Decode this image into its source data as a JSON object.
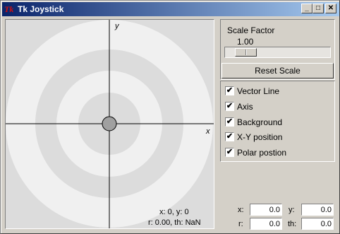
{
  "window": {
    "title": "Tk Joystick",
    "icon_text": "Tk",
    "controls": {
      "minimize": "_",
      "maximize": "□",
      "close": "✕"
    }
  },
  "canvas": {
    "x_axis_label": "x",
    "y_axis_label": "y",
    "readout_xy": "x:    0, y:    0",
    "readout_polar": "r: 0.00, th: NaN"
  },
  "scale": {
    "label": "Scale Factor",
    "value": "1.00",
    "reset_label": "Reset Scale"
  },
  "options": [
    {
      "label": "Vector Line",
      "checked": true
    },
    {
      "label": "Axis",
      "checked": true
    },
    {
      "label": "Background",
      "checked": true
    },
    {
      "label": "X-Y position",
      "checked": true
    },
    {
      "label": "Polar postion",
      "checked": true
    }
  ],
  "fields": {
    "x_label": "x:",
    "x_value": "0.0",
    "y_label": "y:",
    "y_value": "0.0",
    "r_label": "r:",
    "r_value": "0.0",
    "th_label": "th:",
    "th_value": "0.0"
  },
  "colors": {
    "ring_light": "#f0f0f0",
    "ring_dark": "#dcdcdc",
    "knob": "#a0a0a0",
    "title_start": "#0a246a",
    "title_end": "#a6caf0"
  }
}
